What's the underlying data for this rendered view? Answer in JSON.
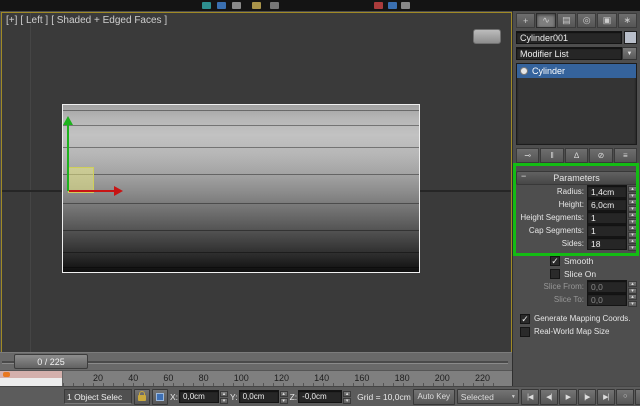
{
  "top_toolbar": {
    "icon_colors": [
      "#2e9090",
      "#3a6fb0",
      "#8a8a8a",
      "#a9944a",
      "#777777",
      "#aa3b3b",
      "#3a6fb0",
      "#888888"
    ]
  },
  "viewport": {
    "label_segments": [
      "[+]",
      "[ Left ]",
      "[ Shaded + Edged Faces ]"
    ]
  },
  "command_panel": {
    "tabs": [
      {
        "name": "create-tab",
        "glyph": "+"
      },
      {
        "name": "modify-tab",
        "glyph": "∿"
      },
      {
        "name": "hierarchy-tab",
        "glyph": "▤"
      },
      {
        "name": "motion-tab",
        "glyph": "◎"
      },
      {
        "name": "display-tab",
        "glyph": "▣"
      },
      {
        "name": "utilities-tab",
        "glyph": "∗"
      }
    ],
    "object_name": "Cylinder001",
    "modifier_list": "Modifier List",
    "modifier_stack": [
      "Cylinder"
    ],
    "stack_buttons": [
      {
        "name": "pin-stack-button",
        "glyph": "⊸"
      },
      {
        "name": "show-end-result-button",
        "glyph": "‖"
      },
      {
        "name": "make-unique-button",
        "glyph": "∆"
      },
      {
        "name": "remove-modifier-button",
        "glyph": "⊘"
      },
      {
        "name": "configure-modifier-sets-button",
        "glyph": "≡"
      }
    ],
    "parameters": {
      "title": "Parameters",
      "rows": [
        {
          "label": "Radius:",
          "value": "1,4cm"
        },
        {
          "label": "Height:",
          "value": "6,0cm"
        },
        {
          "label": "Height Segments:",
          "value": "1"
        },
        {
          "label": "Cap Segments:",
          "value": "1"
        },
        {
          "label": "Sides:",
          "value": "18"
        }
      ],
      "smooth": {
        "label": "Smooth",
        "checked": true
      },
      "slice_on": {
        "label": "Slice On",
        "checked": false
      },
      "slice_from": {
        "label": "Slice From:",
        "value": "0,0"
      },
      "slice_to": {
        "label": "Slice To:",
        "value": "0,0"
      },
      "generate_mapping": {
        "label": "Generate Mapping Coords.",
        "checked": true
      },
      "real_world": {
        "label": "Real-World Map Size",
        "checked": false
      }
    }
  },
  "timeline": {
    "slider_label": "0 / 225",
    "ticks": [
      "20",
      "40",
      "60",
      "80",
      "100",
      "120",
      "140",
      "160",
      "180",
      "200",
      "220"
    ]
  },
  "status_bar": {
    "prompt": "1 Object Selec",
    "coords": {
      "x_label": "X:",
      "x": "0,0cm",
      "y_label": "Y:",
      "y": "0,0cm",
      "z_label": "Z:",
      "z": "-0,0cm"
    },
    "grid": "Grid = 10,0cm",
    "auto_key": "Auto Key",
    "key_filter": "Selected",
    "transport": [
      {
        "name": "go-to-start-button",
        "glyph": "|◀"
      },
      {
        "name": "previous-frame-button",
        "glyph": "◀|"
      },
      {
        "name": "play-button",
        "glyph": "▶"
      },
      {
        "name": "next-frame-button",
        "glyph": "|▶"
      },
      {
        "name": "go-to-end-button",
        "glyph": "▶|"
      }
    ],
    "extra_buttons": [
      {
        "name": "key-mode-toggle-button",
        "glyph": "○"
      },
      {
        "name": "time-configuration-button",
        "glyph": "▦"
      },
      {
        "name": "mini-options-button",
        "glyph": "≡"
      }
    ]
  },
  "colors": {
    "annotation_green": "#13bc13",
    "stack_selection_blue": "#35639c",
    "axis_x_red": "#c81414",
    "axis_y_green": "#1db21d",
    "plane_handle_yellow": "#eeee82",
    "active_viewport_border": "#a08a25"
  }
}
